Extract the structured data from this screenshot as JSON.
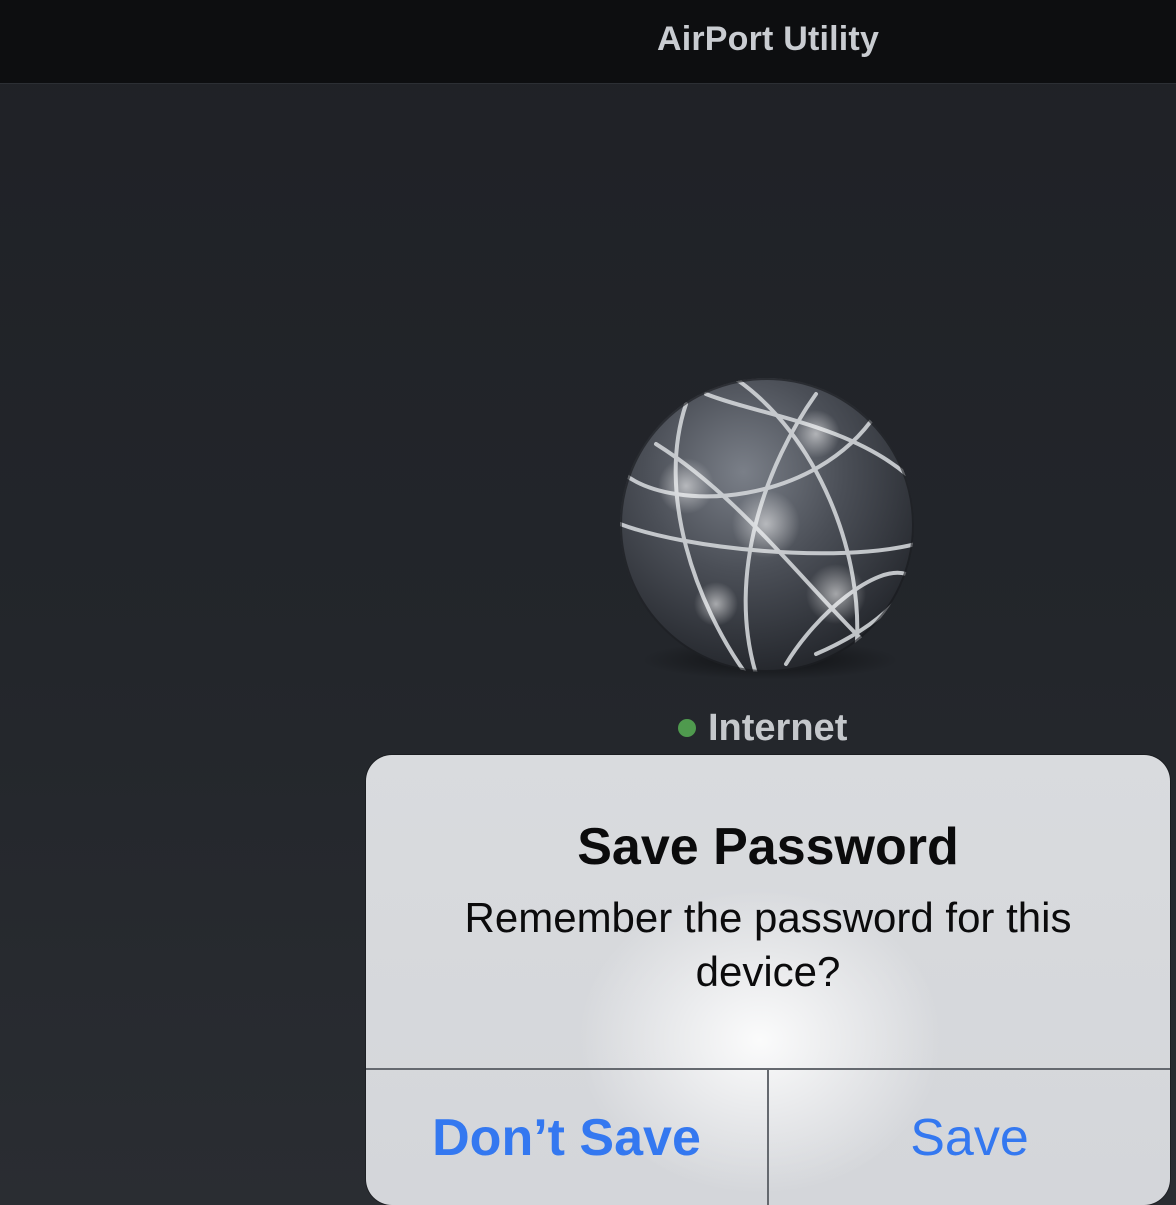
{
  "navbar": {
    "title": "AirPort Utility"
  },
  "network": {
    "icon": "globe-icon",
    "status_label": "Internet",
    "status_color": "#4f9a4e"
  },
  "alert": {
    "title": "Save Password",
    "message": "Remember the password for this device?",
    "buttons": {
      "dont_save": "Don’t Save",
      "save": "Save"
    },
    "accent_color": "#3478f0"
  }
}
